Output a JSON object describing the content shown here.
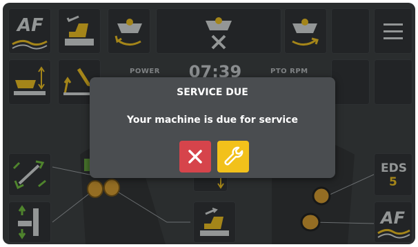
{
  "status_bar": {
    "power_label": "POWER",
    "clock": "07:39",
    "pto_label": "PTO RPM"
  },
  "tiles": {
    "af_top": "AF",
    "af_bottom": "AF",
    "eds_label": "EDS",
    "eds_value": "5"
  },
  "dialog": {
    "title": "SERVICE DUE",
    "message": "Your machine is due for service"
  },
  "colors": {
    "screen_bg": "#37393b",
    "tile_bg": "#2a2c2e",
    "accent_yellow": "#f2c11b",
    "icon_green": "#6fbf3a",
    "cancel_red": "#d6444b",
    "dialog_bg": "#4a4d50"
  }
}
